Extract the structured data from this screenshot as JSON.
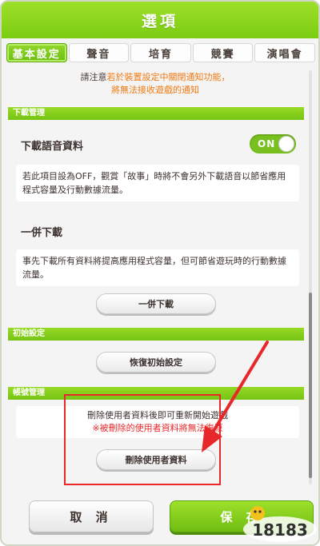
{
  "dialog": {
    "title": "選項"
  },
  "tabs": [
    {
      "label": "基本設定",
      "active": true
    },
    {
      "label": "聲音"
    },
    {
      "label": "培育"
    },
    {
      "label": "競賽"
    },
    {
      "label": "演唱會"
    }
  ],
  "notice": {
    "line1_prefix": "請注意",
    "line1_highlight": "若於裝置設定中關閉通知功能，",
    "line2": "將無法接收遊戲的通知"
  },
  "download": {
    "header": "下載管理",
    "voice_label": "下載語音資料",
    "toggle_state": "ON",
    "voice_desc": "若此項目設為OFF，觀賞「故事」時將不會另外下載語音以節省應用程式容量及行動數據流量。",
    "bulk_label": "一併下載",
    "bulk_desc": "事先下載所有資料將提高應用程式容量，但可節省遊玩時的行動數據流量。",
    "bulk_button": "一併下載"
  },
  "initial": {
    "header": "初始設定",
    "reset_button": "恢復初始設定"
  },
  "account": {
    "header": "帳號管理",
    "desc1": "刪除使用者資料後即可重新開始遊戲",
    "desc2": "※被刪除的使用者資料將無法復原",
    "delete_button": "刪除使用者資料"
  },
  "footer": {
    "cancel_label": "取 消",
    "save_label": "保 存"
  },
  "watermark": {
    "text": "18183"
  },
  "colors": {
    "accent_green": "#7ccc14",
    "highlight_orange": "#ef7a12",
    "warning_red": "#e8272a"
  }
}
